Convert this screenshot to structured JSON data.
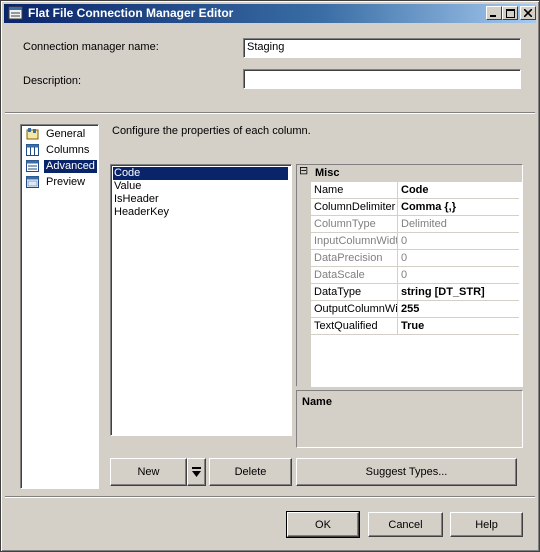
{
  "window": {
    "title": "Flat File Connection Manager Editor"
  },
  "form": {
    "name_label": "Connection manager name:",
    "name_value": "Staging",
    "description_label": "Description:",
    "description_value": ""
  },
  "nav": {
    "items": [
      {
        "label": "General",
        "icon": "general-icon"
      },
      {
        "label": "Columns",
        "icon": "columns-icon"
      },
      {
        "label": "Advanced",
        "icon": "advanced-icon",
        "selected": true
      },
      {
        "label": "Preview",
        "icon": "preview-icon"
      }
    ]
  },
  "main": {
    "instruction": "Configure the properties of each column.",
    "columns": [
      "Code",
      "Value",
      "IsHeader",
      "HeaderKey"
    ],
    "selected_column": "Code"
  },
  "property_grid": {
    "category": "Misc",
    "collapse_glyph": "⊟",
    "rows": [
      {
        "name": "Name",
        "value": "Code",
        "readonly": false,
        "bold": true
      },
      {
        "name": "ColumnDelimiter",
        "value": "Comma {,}",
        "readonly": false,
        "bold": true
      },
      {
        "name": "ColumnType",
        "value": "Delimited",
        "readonly": true,
        "bold": false
      },
      {
        "name": "InputColumnWidth",
        "value": "0",
        "readonly": true,
        "bold": false
      },
      {
        "name": "DataPrecision",
        "value": "0",
        "readonly": true,
        "bold": false
      },
      {
        "name": "DataScale",
        "value": "0",
        "readonly": true,
        "bold": false
      },
      {
        "name": "DataType",
        "value": "string [DT_STR]",
        "readonly": false,
        "bold": true
      },
      {
        "name": "OutputColumnWid",
        "value": "255",
        "readonly": false,
        "bold": true
      },
      {
        "name": "TextQualified",
        "value": "True",
        "readonly": false,
        "bold": true
      }
    ],
    "description_title": "Name"
  },
  "buttons": {
    "new": "New",
    "delete": "Delete",
    "suggest": "Suggest Types...",
    "ok": "OK",
    "cancel": "Cancel",
    "help": "Help"
  },
  "colors": {
    "selection": "#0a246a",
    "face": "#d4d0c8",
    "title_gradient_start": "#0a246a",
    "title_gradient_end": "#a6caf0"
  }
}
